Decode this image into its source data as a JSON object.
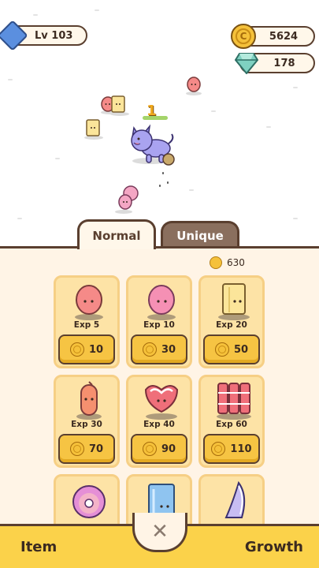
{
  "hud": {
    "level": "Lv 103",
    "coins": "5624",
    "gems": "178"
  },
  "field": {
    "combo": "1"
  },
  "tabs": [
    {
      "label": "Normal",
      "active": true
    },
    {
      "label": "Unique",
      "active": false
    }
  ],
  "shop": {
    "balance": "630",
    "items": [
      {
        "name": "ham-slice-pink",
        "exp": "Exp 5",
        "price": "10"
      },
      {
        "name": "ham-slice-rose",
        "exp": "Exp 10",
        "price": "30"
      },
      {
        "name": "cheese-block",
        "exp": "Exp 20",
        "price": "50"
      },
      {
        "name": "sausage",
        "exp": "Exp 30",
        "price": "70"
      },
      {
        "name": "steak",
        "exp": "Exp 40",
        "price": "90"
      },
      {
        "name": "bacon-strips",
        "exp": "Exp 60",
        "price": "110"
      },
      {
        "name": "ham-steak",
        "exp": "",
        "price": ""
      },
      {
        "name": "ice-block",
        "exp": "",
        "price": ""
      },
      {
        "name": "fish-fillet",
        "exp": "",
        "price": ""
      }
    ]
  },
  "bottom": {
    "item_label": "Item",
    "growth_label": "Growth",
    "close_icon": "close-icon"
  },
  "colors": {
    "panel_bg": "#fff4e6",
    "card_bg": "#fde3a6",
    "button_gold": "#f6c443",
    "outline": "#5a3f2f",
    "bottom_bar": "#fbd24a"
  }
}
